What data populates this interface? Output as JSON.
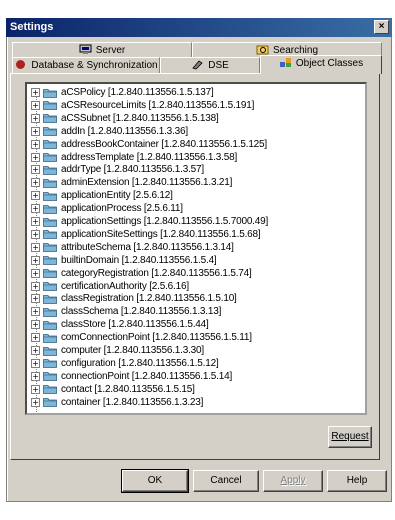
{
  "window": {
    "title": "Settings",
    "close_label": "×"
  },
  "tabs_back": [
    {
      "label": "Server",
      "icon": "server-icon"
    },
    {
      "label": "Searching",
      "icon": "searching-icon"
    }
  ],
  "tabs_front": [
    {
      "label": "Database & Synchronization",
      "icon": "database-icon"
    },
    {
      "label": "DSE",
      "icon": "dse-icon"
    },
    {
      "label": "Object Classes",
      "icon": "object-classes-icon",
      "active": true
    }
  ],
  "tree_items": [
    "aCSPolicy [1.2.840.113556.1.5.137]",
    "aCSResourceLimits [1.2.840.113556.1.5.191]",
    "aCSSubnet [1.2.840.113556.1.5.138]",
    "addIn [1.2.840.113556.1.3.36]",
    "addressBookContainer [1.2.840.113556.1.5.125]",
    "addressTemplate [1.2.840.113556.1.3.58]",
    "addrType [1.2.840.113556.1.3.57]",
    "adminExtension [1.2.840.113556.1.3.21]",
    "applicationEntity [2.5.6.12]",
    "applicationProcess [2.5.6.11]",
    "applicationSettings [1.2.840.113556.1.5.7000.49]",
    "applicationSiteSettings [1.2.840.113556.1.5.68]",
    "attributeSchema [1.2.840.113556.1.3.14]",
    "builtinDomain [1.2.840.113556.1.5.4]",
    "categoryRegistration [1.2.840.113556.1.5.74]",
    "certificationAuthority [2.5.6.16]",
    "classRegistration [1.2.840.113556.1.5.10]",
    "classSchema [1.2.840.113556.1.3.13]",
    "classStore [1.2.840.113556.1.5.44]",
    "comConnectionPoint [1.2.840.113556.1.5.11]",
    "computer [1.2.840.113556.1.3.30]",
    "configuration [1.2.840.113556.1.5.12]",
    "connectionPoint [1.2.840.113556.1.5.14]",
    "contact [1.2.840.113556.1.5.15]",
    "container [1.2.840.113556.1.3.23]"
  ],
  "buttons": {
    "request": "Request",
    "ok": "OK",
    "cancel": "Cancel",
    "apply": "Apply",
    "help": "Help"
  },
  "colors": {
    "titlebar": "#0a246a",
    "face": "#d4d0c8",
    "folder": "#6aa7c8"
  }
}
